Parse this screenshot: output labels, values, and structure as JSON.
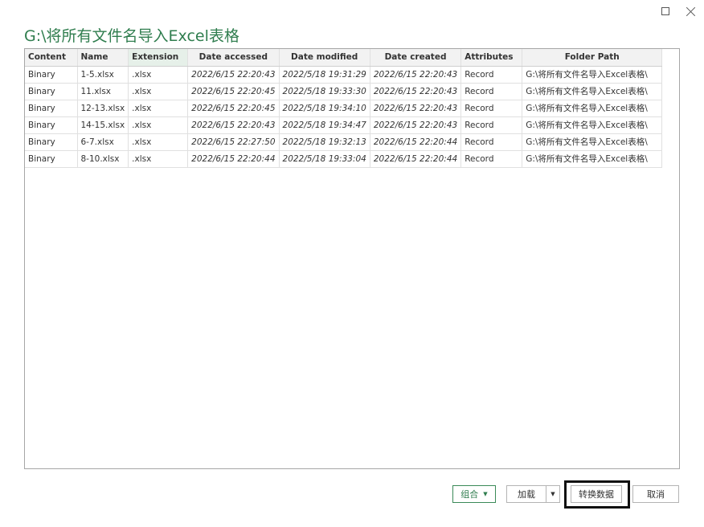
{
  "window": {
    "title": "G:\\将所有文件名导入Excel表格"
  },
  "icons": {
    "maximize": "maximize-icon",
    "close": "close-icon",
    "dropdown": "chevron-down-icon"
  },
  "colors": {
    "accent": "#2f7d4e",
    "header_bg": "#f2f2f2",
    "selected_header_bg": "#e6f0e9"
  },
  "table": {
    "columns": [
      "Content",
      "Name",
      "Extension",
      "Date accessed",
      "Date modified",
      "Date created",
      "Attributes",
      "Folder Path"
    ],
    "rows": [
      [
        "Binary",
        "1-5.xlsx",
        ".xlsx",
        "2022/6/15 22:20:43",
        "2022/5/18 19:31:29",
        "2022/6/15 22:20:43",
        "Record",
        "G:\\将所有文件名导入Excel表格\\"
      ],
      [
        "Binary",
        "11.xlsx",
        ".xlsx",
        "2022/6/15 22:20:45",
        "2022/5/18 19:33:30",
        "2022/6/15 22:20:43",
        "Record",
        "G:\\将所有文件名导入Excel表格\\"
      ],
      [
        "Binary",
        "12-13.xlsx",
        ".xlsx",
        "2022/6/15 22:20:45",
        "2022/5/18 19:34:10",
        "2022/6/15 22:20:43",
        "Record",
        "G:\\将所有文件名导入Excel表格\\"
      ],
      [
        "Binary",
        "14-15.xlsx",
        ".xlsx",
        "2022/6/15 22:20:43",
        "2022/5/18 19:34:47",
        "2022/6/15 22:20:43",
        "Record",
        "G:\\将所有文件名导入Excel表格\\"
      ],
      [
        "Binary",
        "6-7.xlsx",
        ".xlsx",
        "2022/6/15 22:27:50",
        "2022/5/18 19:32:13",
        "2022/6/15 22:20:44",
        "Record",
        "G:\\将所有文件名导入Excel表格\\"
      ],
      [
        "Binary",
        "8-10.xlsx",
        ".xlsx",
        "2022/6/15 22:20:44",
        "2022/5/18 19:33:04",
        "2022/6/15 22:20:44",
        "Record",
        "G:\\将所有文件名导入Excel表格\\"
      ]
    ]
  },
  "buttons": {
    "combine": "组合",
    "load": "加载",
    "transform": "转换数据",
    "cancel": "取消"
  }
}
